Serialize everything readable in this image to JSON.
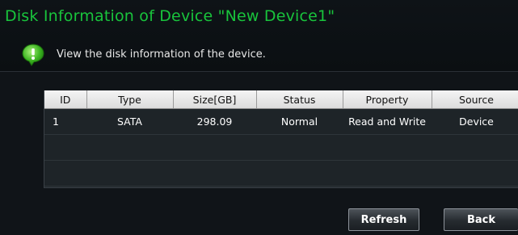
{
  "window": {
    "title": "Disk Information of Device \"New Device1\"",
    "subtitle": "View the disk information of the device."
  },
  "colors": {
    "title": "#19c43c",
    "background": "#101418",
    "table_background": "#1e2428"
  },
  "icons": {
    "info": "info-bubble-icon"
  },
  "table": {
    "columns": [
      "ID",
      "Type",
      "Size[GB]",
      "Status",
      "Property",
      "Source"
    ],
    "rows": [
      {
        "id": "1",
        "type": "SATA",
        "size": "298.09",
        "status": "Normal",
        "property": "Read and Write",
        "source": "Device"
      }
    ]
  },
  "buttons": {
    "refresh": "Refresh",
    "back": "Back"
  }
}
